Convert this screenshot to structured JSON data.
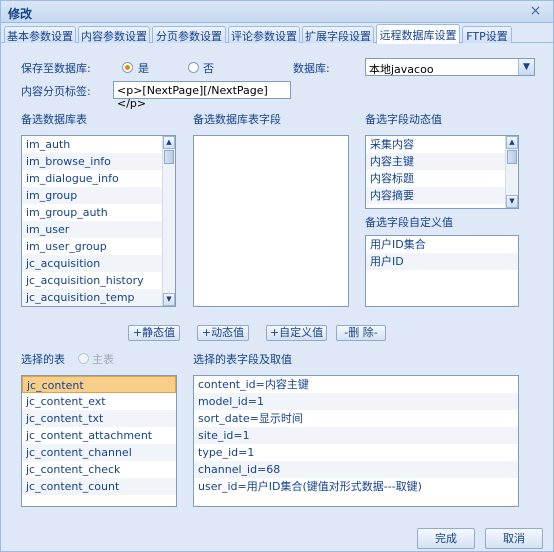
{
  "window": {
    "title": "修改",
    "close_glyph": "×"
  },
  "tabs": [
    "基本参数设置",
    "内容参数设置",
    "分页参数设置",
    "评论参数设置",
    "扩展字段设置",
    "远程数据库设置",
    "FTP设置"
  ],
  "active_tab": "远程数据库设置",
  "save_to_db": {
    "label": "保存至数据库:",
    "yes": "是",
    "no": "否",
    "selected": "是"
  },
  "database": {
    "label": "数据库:",
    "value": "本地javacoo"
  },
  "page_tag": {
    "label": "内容分页标签:",
    "value": "<p>[NextPage][/NextPage]</p>"
  },
  "candidate_tables": {
    "label": "备选数据库表",
    "items": [
      "im_auth",
      "im_browse_info",
      "im_dialogue_info",
      "im_group",
      "im_group_auth",
      "im_user",
      "im_user_group",
      "jc_acquisition",
      "jc_acquisition_history",
      "jc_acquisition_temp"
    ]
  },
  "candidate_table_fields": {
    "label": "备选数据库表字段",
    "items": []
  },
  "dynamic_values": {
    "label": "备选字段动态值",
    "items": [
      "采集内容",
      "内容主键",
      "内容标题",
      "内容摘要"
    ]
  },
  "custom_values": {
    "label": "备选字段自定义值",
    "items": [
      "用户ID集合",
      "用户ID"
    ]
  },
  "action_buttons": {
    "static": "+静态值",
    "dynamic": "+动态值",
    "custom": "+自定义值",
    "delete": "-删 除-"
  },
  "selected_tables": {
    "label": "选择的表",
    "main_label": "主表",
    "selected": "jc_content",
    "items": [
      "jc_content",
      "jc_content_ext",
      "jc_content_txt",
      "jc_content_attachment",
      "jc_content_channel",
      "jc_content_check",
      "jc_content_count"
    ]
  },
  "selected_fields": {
    "label": "选择的表字段及取值",
    "items": [
      "content_id=内容主键",
      "model_id=1",
      "sort_date=显示时间",
      "site_id=1",
      "type_id=1",
      "channel_id=68",
      "user_id=用户ID集合(键值对形式数据---取键)"
    ]
  },
  "footer": {
    "ok": "完成",
    "cancel": "取消"
  }
}
